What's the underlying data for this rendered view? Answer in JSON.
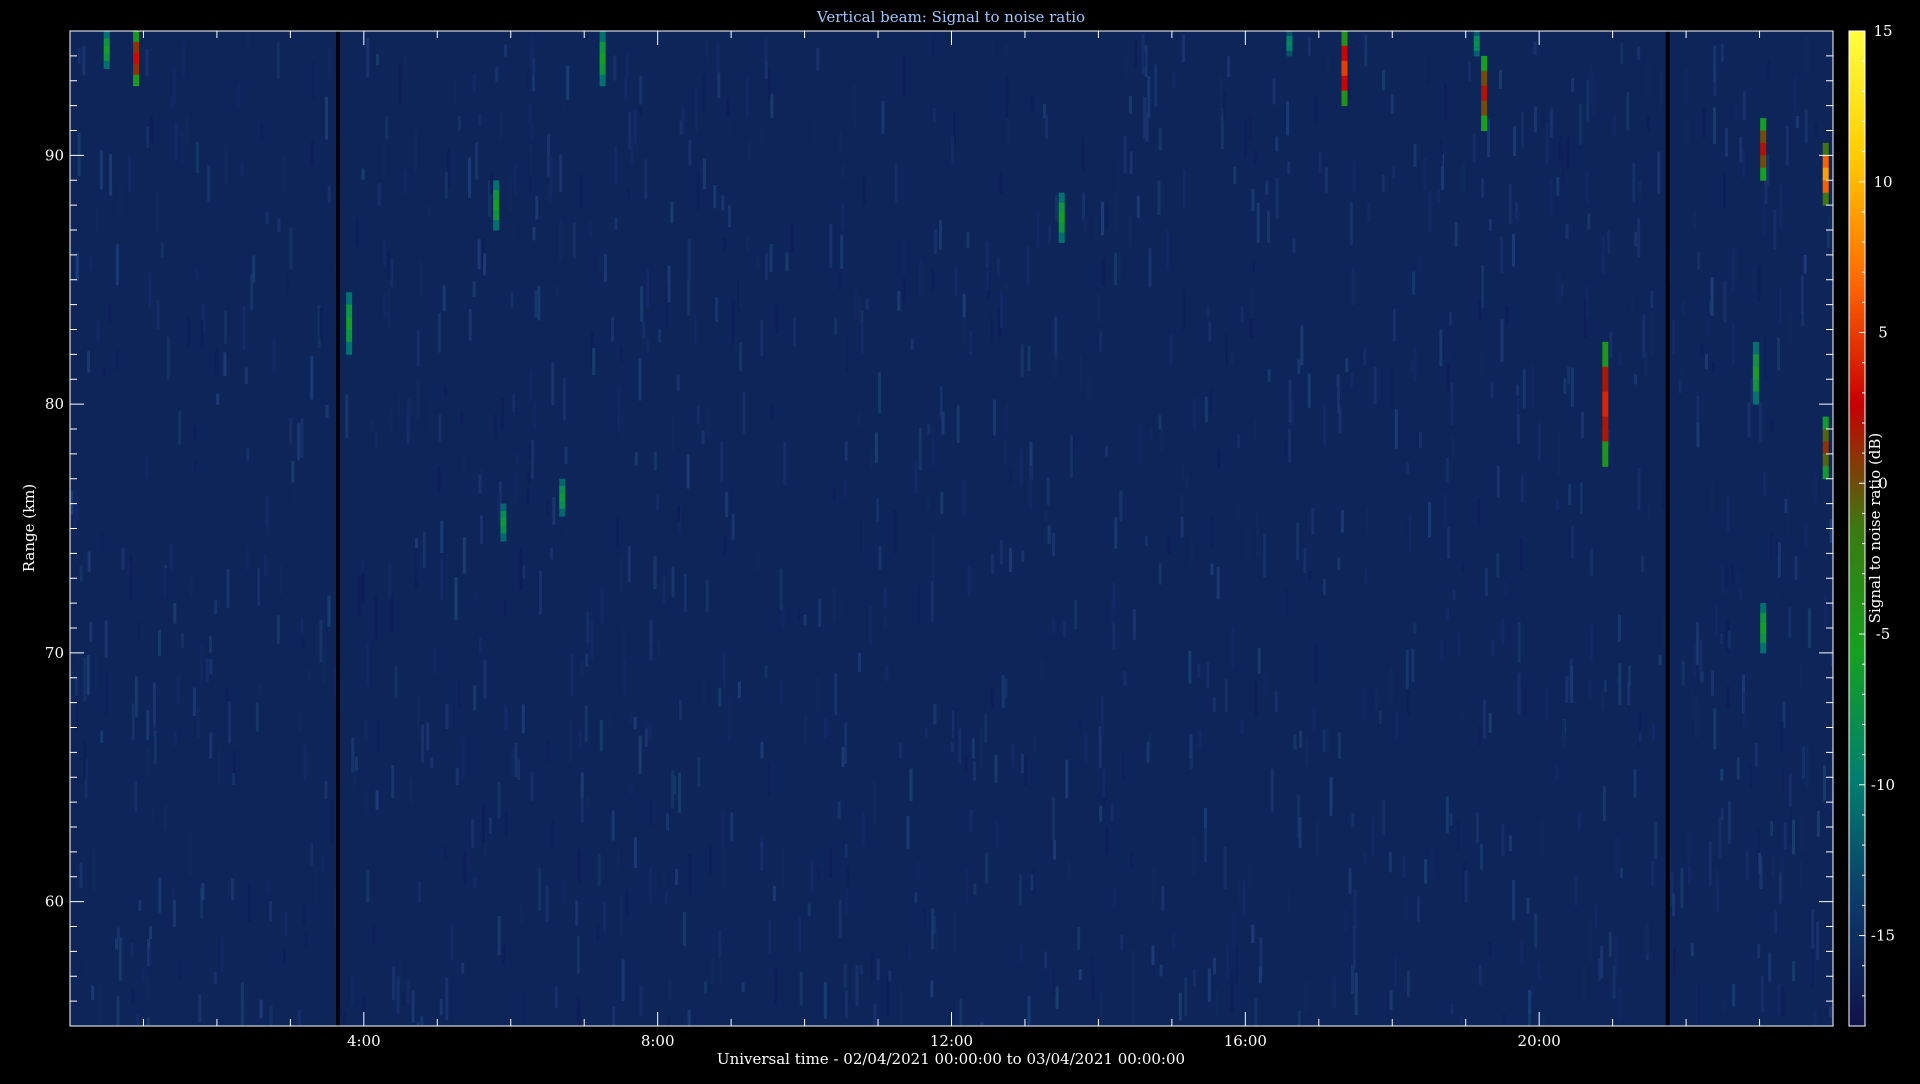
{
  "chart_data": {
    "type": "heatmap",
    "title": "Vertical beam: Signal to noise ratio",
    "xlabel": "Universal time - 02/04/2021 00:00:00 to 03/04/2021 00:00:00",
    "ylabel": "Range (km)",
    "colorbar_label": "Signal to noise ratio (dB)",
    "x_unit": "hours UT",
    "xlim": [
      0,
      24
    ],
    "ylim": [
      55,
      95
    ],
    "clim": [
      -18,
      15
    ],
    "x_ticks": [
      {
        "value": 4,
        "label": "4:00"
      },
      {
        "value": 8,
        "label": "8:00"
      },
      {
        "value": 12,
        "label": "12:00"
      },
      {
        "value": 16,
        "label": "16:00"
      },
      {
        "value": 20,
        "label": "20:00"
      }
    ],
    "y_ticks": [
      {
        "value": 60,
        "label": "60"
      },
      {
        "value": 70,
        "label": "70"
      },
      {
        "value": 80,
        "label": "80"
      },
      {
        "value": 90,
        "label": "90"
      }
    ],
    "colorbar_ticks": [
      {
        "value": 15,
        "label": "15"
      },
      {
        "value": 10,
        "label": "10"
      },
      {
        "value": 5,
        "label": "5"
      },
      {
        "value": 0,
        "label": "0"
      },
      {
        "value": -5,
        "label": "-5"
      },
      {
        "value": -10,
        "label": "-10"
      },
      {
        "value": -15,
        "label": "-15"
      }
    ],
    "colormap": [
      "#10124a",
      "#0c3a6a",
      "#00806e",
      "#16a020",
      "#3a7a10",
      "#c80000",
      "#ff6a00",
      "#ffcc00",
      "#ffff40"
    ],
    "background_snr_db": -16,
    "data_gaps_hours": [
      3.65,
      21.75
    ],
    "echoes": [
      {
        "t": 0.5,
        "r0": 93.5,
        "r1": 95.0,
        "snr": -6
      },
      {
        "t": 0.9,
        "r0": 92.8,
        "r1": 95.0,
        "snr": 3
      },
      {
        "t": 3.8,
        "r0": 82.0,
        "r1": 84.5,
        "snr": -6
      },
      {
        "t": 5.8,
        "r0": 87.0,
        "r1": 89.0,
        "snr": -6
      },
      {
        "t": 5.9,
        "r0": 74.5,
        "r1": 76.0,
        "snr": -7
      },
      {
        "t": 6.7,
        "r0": 75.5,
        "r1": 77.0,
        "snr": -7
      },
      {
        "t": 7.25,
        "r0": 92.8,
        "r1": 95.0,
        "snr": -6
      },
      {
        "t": 13.5,
        "r0": 86.5,
        "r1": 88.5,
        "snr": -6
      },
      {
        "t": 16.6,
        "r0": 94.0,
        "r1": 95.0,
        "snr": -9
      },
      {
        "t": 17.35,
        "r0": 92.0,
        "r1": 95.0,
        "snr": 5
      },
      {
        "t": 19.15,
        "r0": 94.0,
        "r1": 95.0,
        "snr": -8
      },
      {
        "t": 19.25,
        "r0": 91.0,
        "r1": 94.0,
        "snr": 2
      },
      {
        "t": 20.9,
        "r0": 77.5,
        "r1": 82.5,
        "snr": 4
      },
      {
        "t": 22.95,
        "r0": 80.0,
        "r1": 82.5,
        "snr": -6
      },
      {
        "t": 23.05,
        "r0": 89.0,
        "r1": 91.5,
        "snr": 2
      },
      {
        "t": 23.05,
        "r0": 70.0,
        "r1": 72.0,
        "snr": -6
      },
      {
        "t": 23.9,
        "r0": 88.0,
        "r1": 90.5,
        "snr": 9
      },
      {
        "t": 23.9,
        "r0": 77.0,
        "r1": 79.5,
        "snr": 1
      }
    ]
  }
}
